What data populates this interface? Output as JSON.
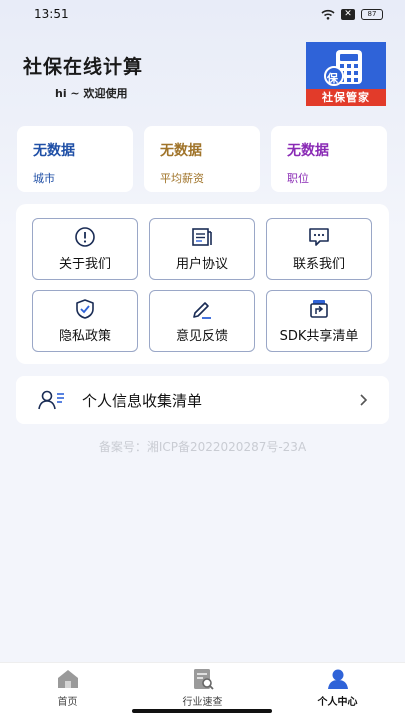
{
  "status_bar": {
    "time": "13:51",
    "battery": "87"
  },
  "header": {
    "title": "社保在线计算",
    "greeting": "hi ~ 欢迎使用",
    "logo_text": "社保管家",
    "logo_glyph": "保"
  },
  "stats": [
    {
      "value": "无数据",
      "label": "城市",
      "color": "#1f4fa6"
    },
    {
      "value": "无数据",
      "label": "平均薪资",
      "color": "#a0742a"
    },
    {
      "value": "无数据",
      "label": "职位",
      "color": "#8a2bb5"
    }
  ],
  "menu": {
    "about": "关于我们",
    "agreement": "用户协议",
    "contact": "联系我们",
    "privacy_policy": "隐私政策",
    "feedback": "意见反馈",
    "sdk_list": "SDK共享清单"
  },
  "privacy_row": {
    "label": "个人信息收集清单"
  },
  "icp": "备案号：湘ICP备2022020287号-23A",
  "bottom_nav": {
    "home": "首页",
    "industry": "行业速查",
    "profile": "个人中心"
  }
}
